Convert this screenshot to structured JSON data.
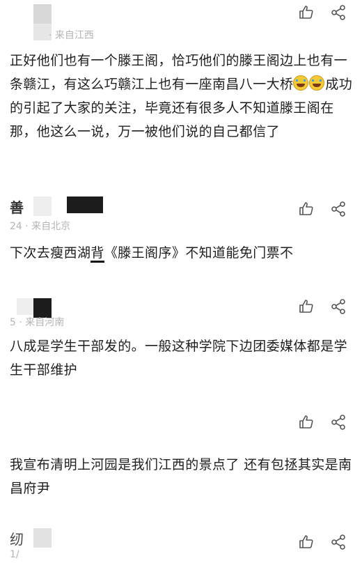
{
  "comments": [
    {
      "name": "",
      "meta": "·  来自江西",
      "text_parts": [
        "正好他们也有一个滕王阁，恰巧他们的滕王阁边上也有一条赣江，有这么巧赣江上也有一座南昌八一大桥",
        "成功的引起了大家的关注，毕竟还有很多人不知道滕王阁在那，他这么一说，万一被他们说的自己都信了"
      ],
      "emoji": [
        "laugh-cry-emoji",
        "laugh-cry-emoji"
      ]
    },
    {
      "name": "善",
      "meta": "24  ·  来自北京",
      "text_before": "下次去瘦西湖",
      "text_marked": "背",
      "text_after": "《滕王阁序》不知道能免门票不"
    },
    {
      "name": "",
      "meta": "5  ·  来自河南",
      "text": "八成是学生干部发的。一般这种学院下边团委媒体都是学生干部维护"
    },
    {
      "name": "",
      "meta": "",
      "text": "我宣布清明上河园是我们江西的景点了 还有包拯其实是南昌府尹"
    },
    {
      "name": "纫",
      "meta": "1/",
      "text": ""
    }
  ],
  "icons": {
    "like": "thumbs-up-icon",
    "share": "share-icon"
  },
  "colors": {
    "text": "#1e1e1e",
    "meta": "#b4b4b4",
    "icon": "#555555",
    "redaction_light": "#d8d8d8",
    "redaction_dark": "#1c1c1c"
  }
}
